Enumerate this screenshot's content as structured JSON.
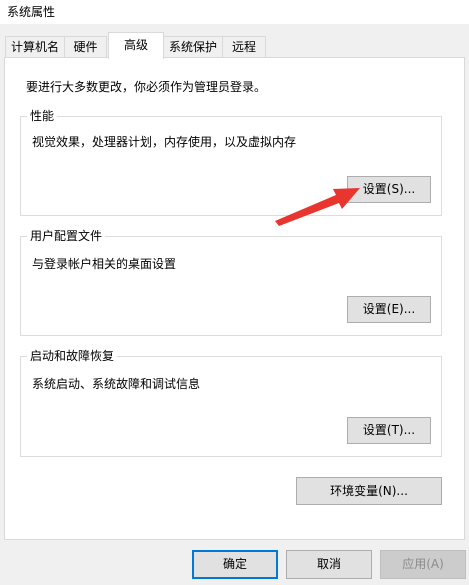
{
  "window": {
    "title": "系统属性"
  },
  "tabs": [
    {
      "label": "计算机名"
    },
    {
      "label": "硬件"
    },
    {
      "label": "高级"
    },
    {
      "label": "系统保护"
    },
    {
      "label": "远程"
    }
  ],
  "active_tab": "高级",
  "notice": "要进行大多数更改，你必须作为管理员登录。",
  "groups": {
    "performance": {
      "title": "性能",
      "description": "视觉效果，处理器计划，内存使用，以及虚拟内存",
      "button": "设置(S)..."
    },
    "user_profiles": {
      "title": "用户配置文件",
      "description": "与登录帐户相关的桌面设置",
      "button": "设置(E)..."
    },
    "startup_recovery": {
      "title": "启动和故障恢复",
      "description": "系统启动、系统故障和调试信息",
      "button": "设置(T)..."
    }
  },
  "env_button": "环境变量(N)...",
  "footer": {
    "ok": "确定",
    "cancel": "取消",
    "apply": "应用(A)"
  },
  "colors": {
    "annotation_arrow": "#e8352e",
    "default_button_border": "#0078d7"
  }
}
